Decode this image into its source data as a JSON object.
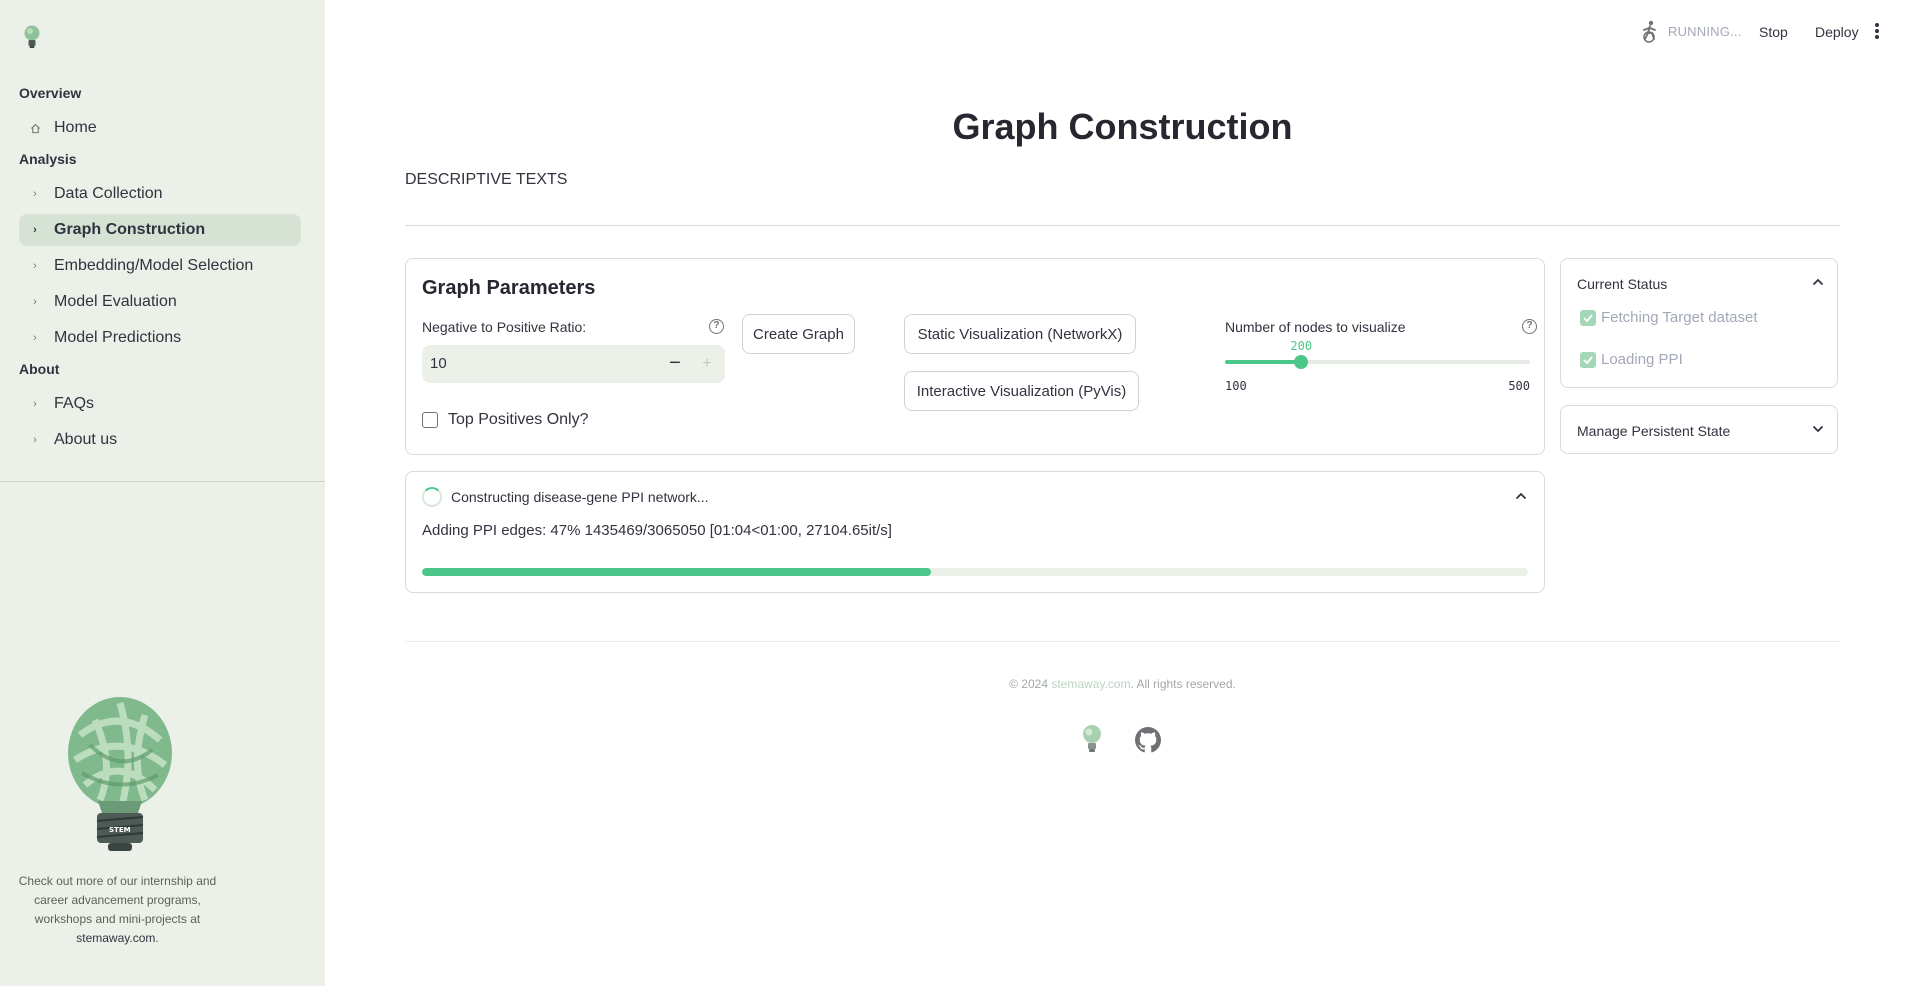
{
  "sidebar": {
    "sections": [
      {
        "label": "Overview",
        "items": [
          {
            "label": "Home",
            "icon": "home-icon"
          }
        ]
      },
      {
        "label": "Analysis",
        "items": [
          {
            "label": "Data Collection",
            "icon": "chevron-right-icon"
          },
          {
            "label": "Graph Construction",
            "icon": "chevron-right-icon",
            "active": true
          },
          {
            "label": "Embedding/Model Selection",
            "icon": "chevron-right-icon"
          },
          {
            "label": "Model Evaluation",
            "icon": "chevron-right-icon"
          },
          {
            "label": "Model Predictions",
            "icon": "chevron-right-icon"
          }
        ]
      },
      {
        "label": "About",
        "items": [
          {
            "label": "FAQs",
            "icon": "chevron-right-icon"
          },
          {
            "label": "About us",
            "icon": "chevron-right-icon"
          }
        ]
      }
    ],
    "footer_text": "Check out more of our internship and career advancement programs, workshops and mini-projects at",
    "footer_link": "stemaway.com",
    "footer_period": ".",
    "logo_text": "STEM"
  },
  "header": {
    "status": "RUNNING...",
    "stop": "Stop",
    "deploy": "Deploy"
  },
  "page": {
    "title": "Graph Construction",
    "description": "DESCRIPTIVE TEXTS"
  },
  "params": {
    "heading": "Graph Parameters",
    "ratio_label": "Negative to Positive Ratio:",
    "ratio_value": "10",
    "create_button": "Create Graph",
    "static_button": "Static Visualization (NetworkX)",
    "interactive_button": "Interactive Visualization (PyVis)",
    "top_positives_label": "Top Positives Only?",
    "slider": {
      "label": "Number of nodes to visualize",
      "min": 100,
      "max": 500,
      "value": 200,
      "min_label": "100",
      "max_label": "500",
      "value_label": "200"
    }
  },
  "progress": {
    "heading": "Constructing disease-gene PPI network...",
    "text": "Adding PPI edges: 47% 1435469/3065050 [01:04<01:00, 27104.65it/s]",
    "fraction": 0.46
  },
  "status_panel": {
    "heading": "Current Status",
    "items": [
      "Fetching Target dataset",
      "Loading PPI"
    ]
  },
  "persist_panel": {
    "heading": "Manage Persistent State"
  },
  "footer": {
    "copyright_prefix": "© 2024 ",
    "copyright_link": "stemaway.com",
    "copyright_suffix": ". All rights reserved."
  },
  "colors": {
    "accent": "#4bc78a",
    "sidebar_bg": "#ebf1e9",
    "active_item_bg": "#d6e2d3"
  }
}
